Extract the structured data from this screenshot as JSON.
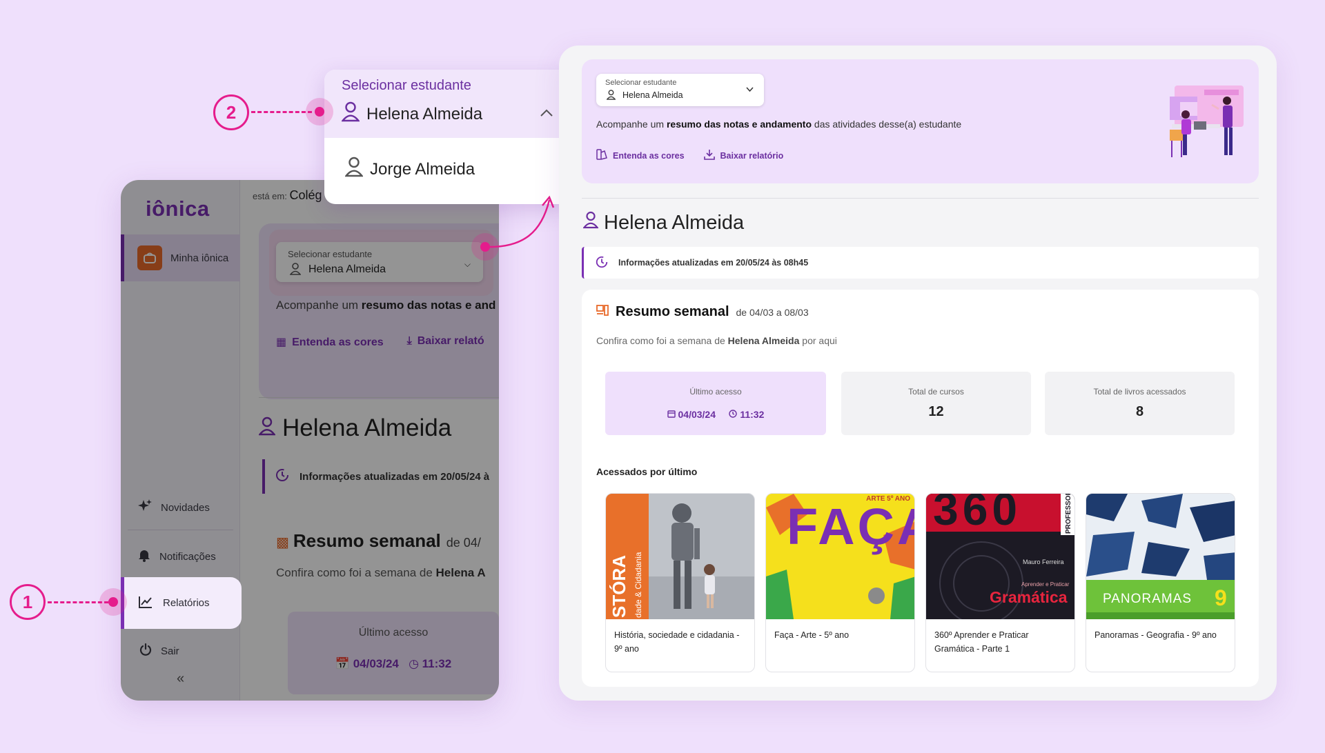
{
  "left_app": {
    "logo": "iônica",
    "breadcrumb_prefix": "está em:",
    "breadcrumb_value": "Colég",
    "sidebar": {
      "minha_ionica": "Minha iônica",
      "novidades": "Novidades",
      "notificacoes": "Notificações",
      "relatorios": "Relatórios",
      "sair": "Sair",
      "collapse": "«"
    },
    "select": {
      "label": "Selecionar estudante",
      "value": "Helena Almeida"
    },
    "desc_pre": "Acompanhe um ",
    "desc_bold": "resumo das notas e and",
    "links": {
      "entenda": "Entenda as cores",
      "baixar": "Baixar relató"
    },
    "student_name": "Helena Almeida",
    "info": "Informações atualizadas em 20/05/24 à",
    "resumo_title": "Resumo semanal",
    "resumo_dates": "de 04/",
    "confira_pre": "Confira como foi a semana de ",
    "confira_bold": "Helena A",
    "ultimo_label": "Último acesso",
    "ultimo_date": "04/03/24",
    "ultimo_time": "11:32"
  },
  "dropdown": {
    "label": "Selecionar estudante",
    "selected": "Helena Almeida",
    "options": [
      "Jorge Almeida"
    ]
  },
  "callouts": {
    "one": "1",
    "two": "2"
  },
  "main": {
    "select": {
      "label": "Selecionar estudante",
      "value": "Helena Almeida"
    },
    "desc_pre": "Acompanhe um ",
    "desc_bold": "resumo das notas e andamento",
    "desc_post": " das atividades desse(a) estudante",
    "links": {
      "entenda": "Entenda as cores",
      "baixar": "Baixar relatório"
    },
    "student_name": "Helena Almeida",
    "info": "Informações atualizadas em 20/05/24 às 08h45",
    "resumo_title": "Resumo semanal",
    "resumo_dates": "de 04/03 a 08/03",
    "confira_pre": "Confira como foi a semana de ",
    "confira_bold": "Helena Almeida",
    "confira_post": " por aqui",
    "stats": {
      "ultimo_label": "Último acesso",
      "ultimo_date": "04/03/24",
      "ultimo_time": "11:32",
      "cursos_label": "Total de cursos",
      "cursos_value": "12",
      "livros_label": "Total de livros acessados",
      "livros_value": "8"
    },
    "acessados_title": "Acessados por último",
    "books": [
      {
        "title": "História, sociedade e cidadania - 9º ano",
        "cover_text": "STÓRA",
        "cover_sub": "dade & Cidadania"
      },
      {
        "title": "Faça - Arte - 5º ano",
        "cover_text": "FAÇA!",
        "cover_sub": "ARTE 5º ANO"
      },
      {
        "title": "360º Aprender e Praticar Gramática - Parte 1",
        "cover_text": "Gramática",
        "cover_sub": "Mauro Ferreira",
        "cover_top": "360",
        "cover_side": "PROFESSOR",
        "cover_tag": "Aprender e Praticar"
      },
      {
        "title": "Panoramas - Geografia - 9º ano",
        "cover_text": "PANORAMAS",
        "cover_sub": "9"
      }
    ]
  },
  "colors": {
    "background": "#efe0fc",
    "brand_purple": "#7a2fb3",
    "accent_pink": "#e51c8c",
    "hero_lilac": "#efe0fc",
    "orange": "#e86a2a"
  },
  "icons": [
    "user-icon",
    "chevron-down-icon",
    "chevron-up-icon",
    "palette-icon",
    "download-icon",
    "history-icon",
    "summary-icon",
    "calendar-icon",
    "clock-icon",
    "sparkle-icon",
    "bell-icon",
    "chart-icon",
    "power-icon"
  ]
}
